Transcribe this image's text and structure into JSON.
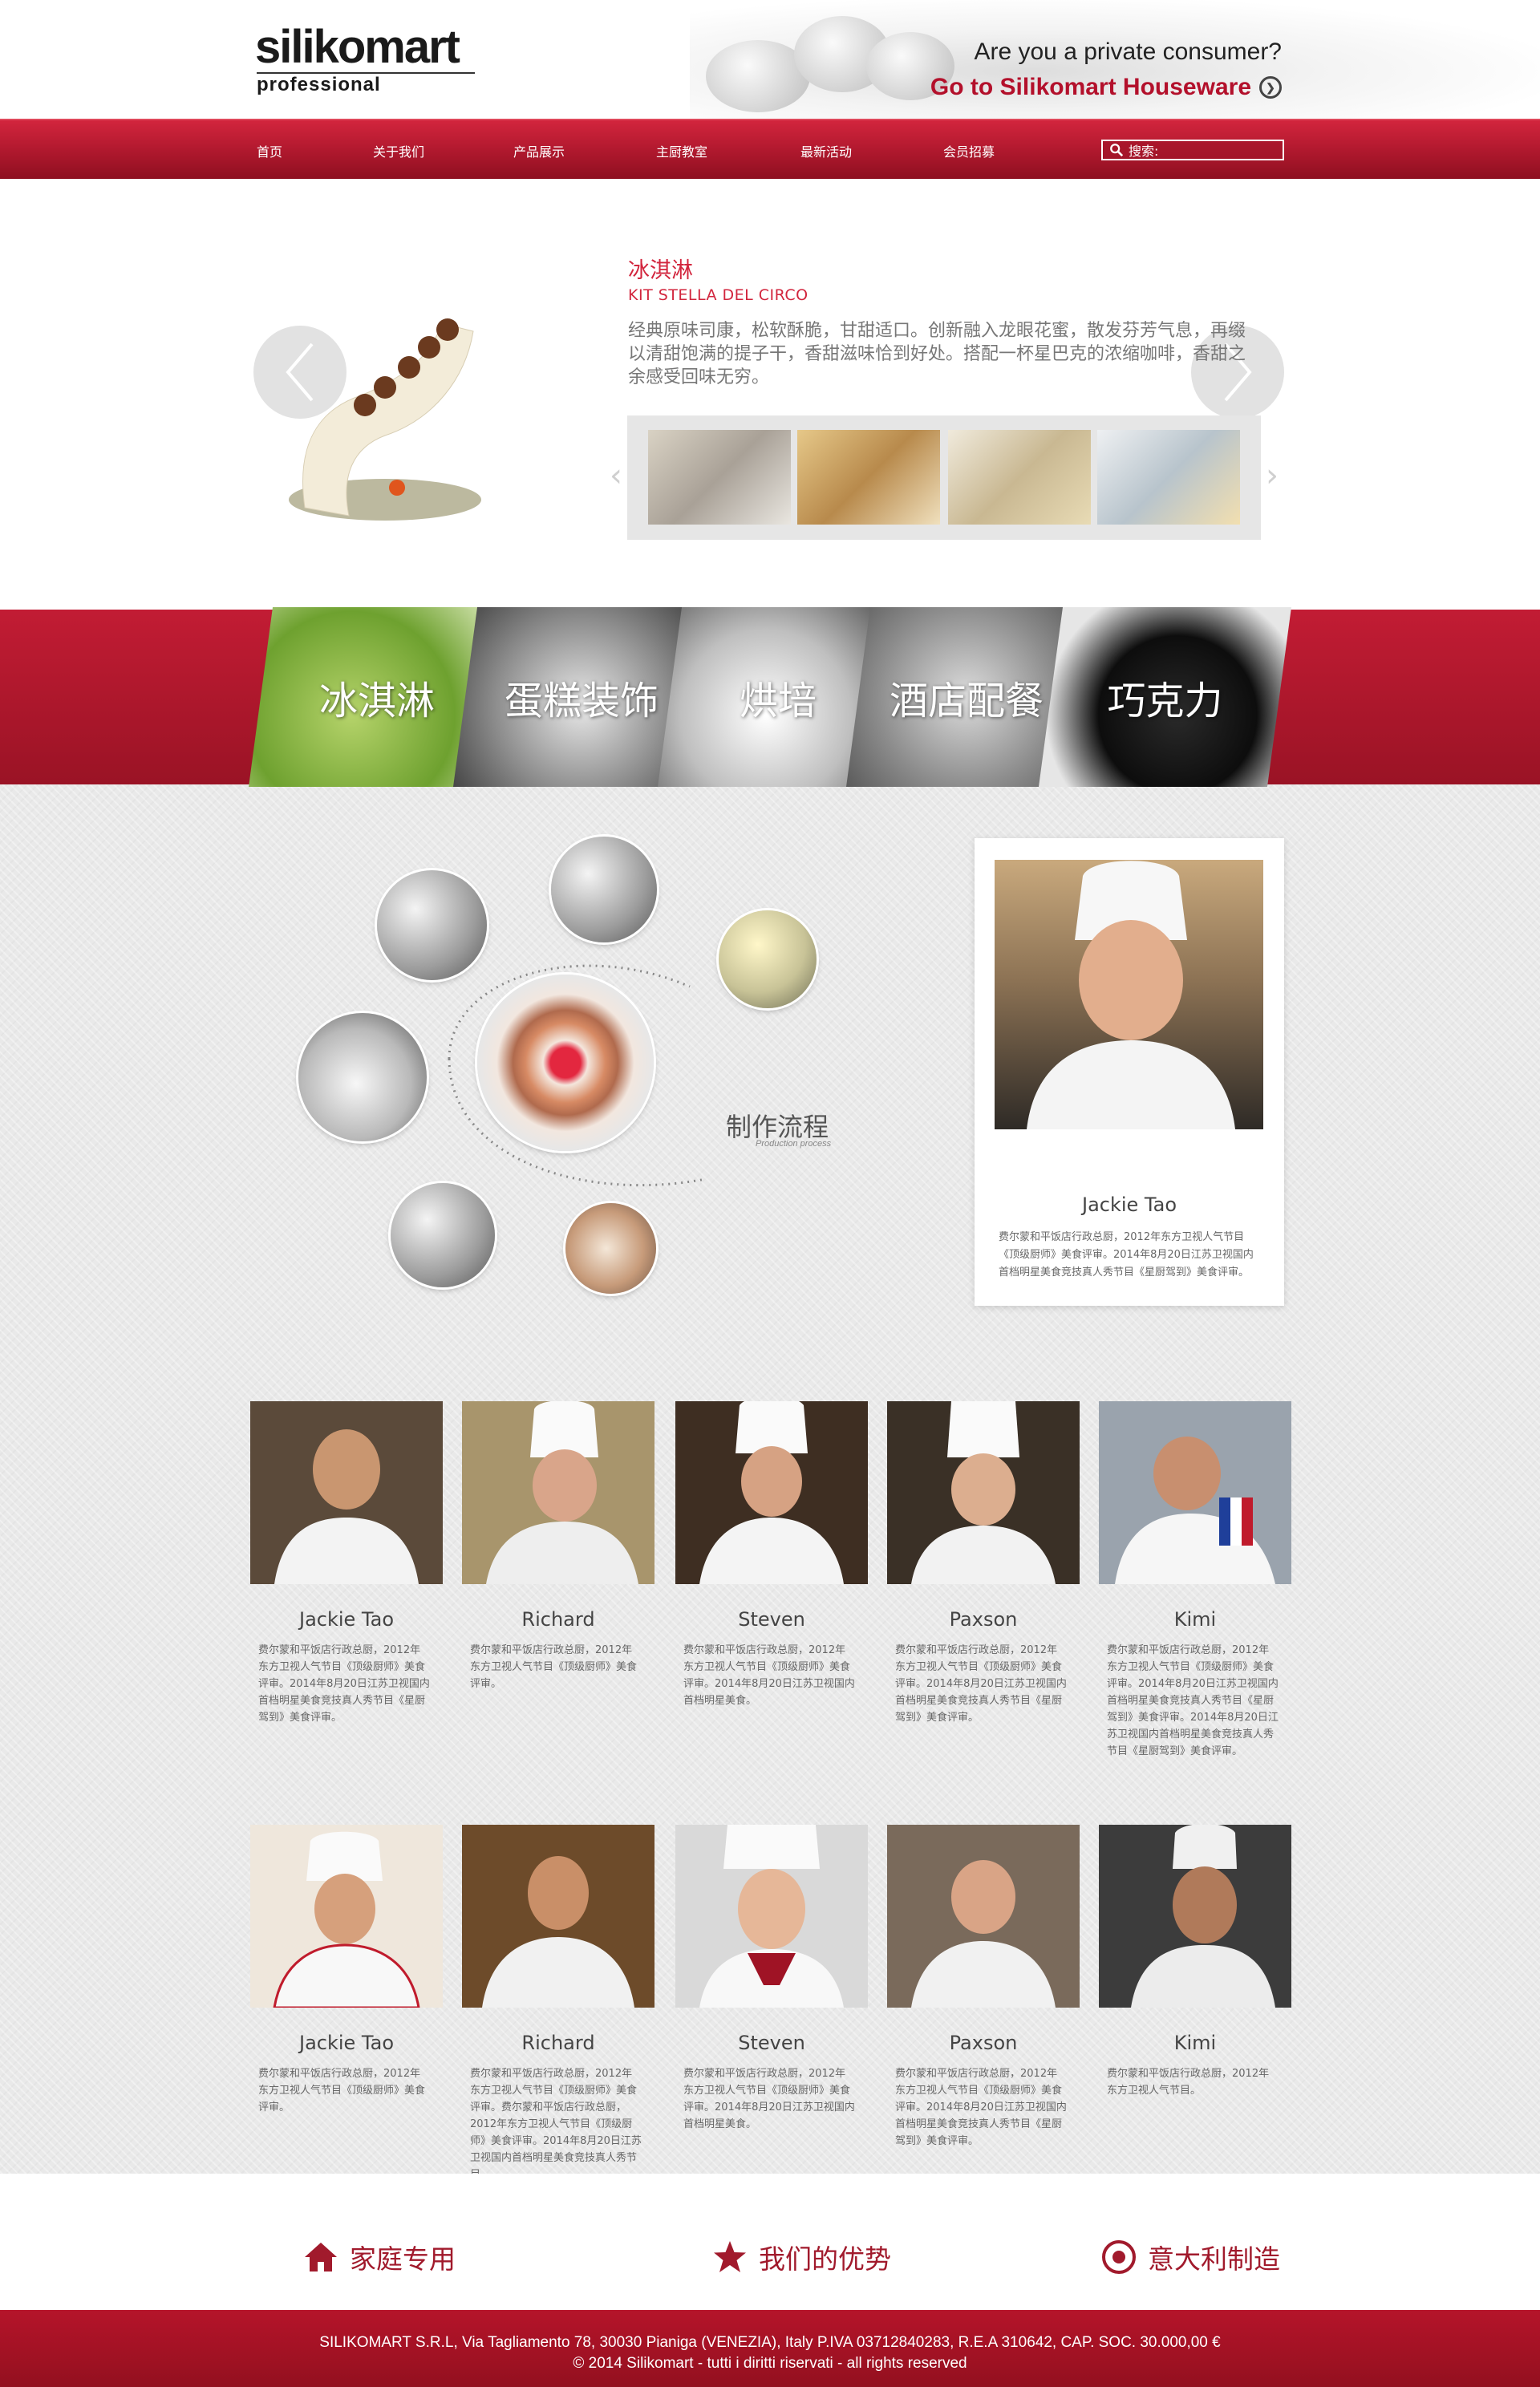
{
  "header": {
    "logo_main": "silikomart",
    "logo_sub": "professional",
    "consumer_question": "Are you a private consumer?",
    "houseware_link": "Go to Silikomart Houseware"
  },
  "nav": {
    "items": [
      "首页",
      "关于我们",
      "产品展示",
      "主厨教室",
      "最新活动",
      "会员招募"
    ],
    "search_label": "搜索:"
  },
  "hero": {
    "title": "冰淇淋",
    "subtitle": "KIT STELLA DEL CIRCO",
    "description": "经典原味司康，松软酥脆，甘甜适口。创新融入龙眼花蜜，散发芬芳气息，再缀以清甜饱满的提子干，香甜滋味恰到好处。搭配一杯星巴克的浓缩咖啡，香甜之余感受回味无穷。"
  },
  "categories": [
    "冰淇淋",
    "蛋糕装饰",
    "烘培",
    "酒店配餐",
    "巧克力"
  ],
  "process": {
    "title": "制作流程",
    "subtitle": "Production process"
  },
  "featured_chef": {
    "name": "Jackie Tao",
    "description": "费尔蒙和平饭店行政总厨，2012年东方卫视人气节目《顶级厨师》美食评审。2014年8月20日江苏卫视国内首档明星美食竞技真人秀节目《星厨驾到》美食评审。"
  },
  "chefs_row1": [
    {
      "name": "Jackie Tao",
      "description": "费尔蒙和平饭店行政总厨，2012年东方卫视人气节目《顶级厨师》美食评审。2014年8月20日江苏卫视国内首档明星美食竞技真人秀节目《星厨驾到》美食评审。"
    },
    {
      "name": "Richard",
      "description": "费尔蒙和平饭店行政总厨，2012年东方卫视人气节目《顶级厨师》美食评审。"
    },
    {
      "name": "Steven",
      "description": "费尔蒙和平饭店行政总厨，2012年东方卫视人气节目《顶级厨师》美食评审。2014年8月20日江苏卫视国内首档明星美食。"
    },
    {
      "name": "Paxson",
      "description": "费尔蒙和平饭店行政总厨，2012年东方卫视人气节目《顶级厨师》美食评审。2014年8月20日江苏卫视国内首档明星美食竞技真人秀节目《星厨驾到》美食评审。"
    },
    {
      "name": "Kimi",
      "description": "费尔蒙和平饭店行政总厨，2012年东方卫视人气节目《顶级厨师》美食评审。2014年8月20日江苏卫视国内首档明星美食竞技真人秀节目《星厨驾到》美食评审。2014年8月20日江苏卫视国内首档明星美食竞技真人秀节目《星厨驾到》美食评审。"
    }
  ],
  "chefs_row2": [
    {
      "name": "Jackie Tao",
      "description": "费尔蒙和平饭店行政总厨，2012年东方卫视人气节目《顶级厨师》美食评审。"
    },
    {
      "name": "Richard",
      "description": "费尔蒙和平饭店行政总厨，2012年东方卫视人气节目《顶级厨师》美食评审。费尔蒙和平饭店行政总厨，2012年东方卫视人气节目《顶级厨师》美食评审。2014年8月20日江苏卫视国内首档明星美食竞技真人秀节目"
    },
    {
      "name": "Steven",
      "description": "费尔蒙和平饭店行政总厨，2012年东方卫视人气节目《顶级厨师》美食评审。2014年8月20日江苏卫视国内首档明星美食。"
    },
    {
      "name": "Paxson",
      "description": "费尔蒙和平饭店行政总厨，2012年东方卫视人气节目《顶级厨师》美食评审。2014年8月20日江苏卫视国内首档明星美食竞技真人秀节目《星厨驾到》美食评审。"
    },
    {
      "name": "Kimi",
      "description": "费尔蒙和平饭店行政总厨，2012年东方卫视人气节目。"
    }
  ],
  "footer_links": {
    "home_use": "家庭专用",
    "advantages": "我们的优势",
    "made_in_italy": "意大利制造"
  },
  "footer": {
    "line1": "SILIKOMART S.R.L, Via Tagliamento 78, 30030 Pianiga (VENEZIA), Italy P.IVA 03712840283, R.E.A 310642, CAP. SOC. 30.000,00 €",
    "line2": "© 2014 Silikomart - tutti i diritti riservati - all rights reserved"
  },
  "colors": {
    "brand_red": "#b3102b",
    "nav_red": "#c21c34",
    "text_gray": "#666666"
  }
}
